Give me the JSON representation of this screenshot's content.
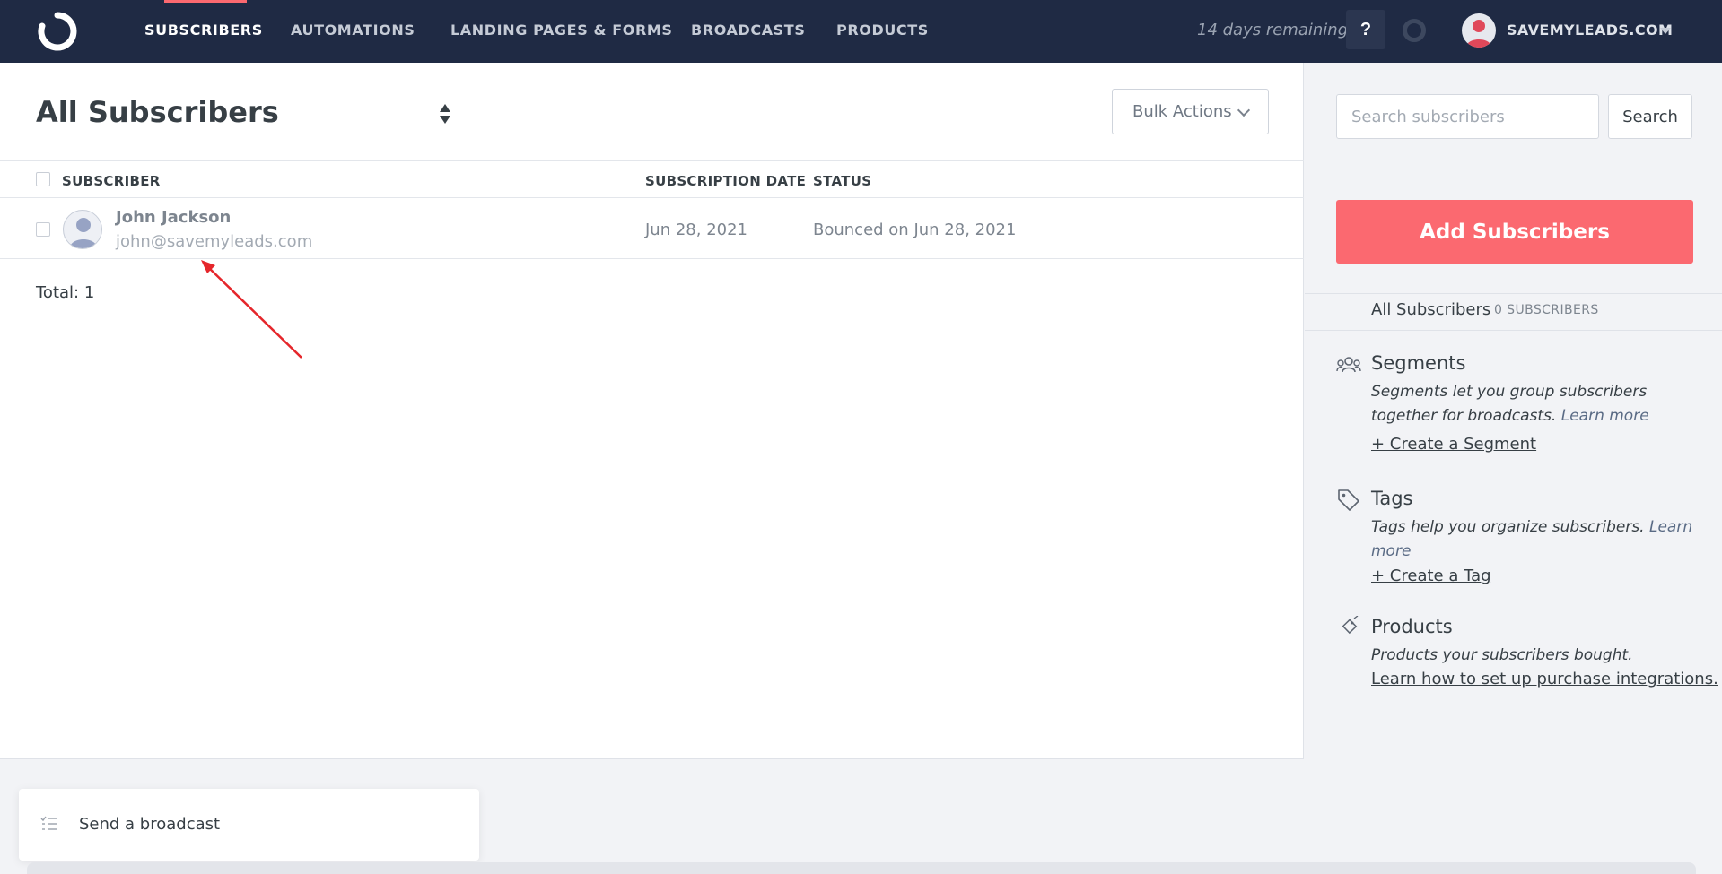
{
  "nav": {
    "items": [
      {
        "label": "SUBSCRIBERS",
        "active": true
      },
      {
        "label": "AUTOMATIONS"
      },
      {
        "label": "LANDING PAGES & FORMS"
      },
      {
        "label": "BROADCASTS"
      },
      {
        "label": "PRODUCTS"
      }
    ],
    "trial_text": "14 days remaining",
    "help_label": "?",
    "account_name": "SAVEMYLEADS.COM"
  },
  "main": {
    "title": "All Subscribers",
    "bulk_actions_label": "Bulk Actions",
    "columns": {
      "subscriber": "SUBSCRIBER",
      "date": "SUBSCRIPTION DATE",
      "status": "STATUS"
    },
    "rows": [
      {
        "name": "John Jackson",
        "email": "john@savemyleads.com",
        "date": "Jun 28, 2021",
        "status": "Bounced on Jun 28, 2021"
      }
    ],
    "total_text": "Total: 1"
  },
  "sidebar": {
    "search_placeholder": "Search subscribers",
    "search_label": "Search",
    "add_label": "Add Subscribers",
    "all_label": "All Subscribers",
    "all_count": "0 SUBSCRIBERS",
    "segments": {
      "title": "Segments",
      "desc": "Segments let you group subscribers together for broadcasts.",
      "learn_more": "Learn more",
      "link": "+ Create a Segment"
    },
    "tags": {
      "title": "Tags",
      "desc": "Tags help you organize subscribers.",
      "learn_more": "Learn more",
      "link": "+ Create a Tag"
    },
    "products": {
      "title": "Products",
      "desc": "Products your subscribers bought.",
      "link": "Learn how to set up purchase integrations."
    }
  },
  "footer": {
    "broadcast_label": "Send a broadcast"
  },
  "colors": {
    "nav_bg": "#1f2a44",
    "accent": "#fb6970",
    "annotation_arrow": "#e5262b"
  },
  "icons": [
    "logo-icon",
    "help-icon",
    "status-ring-icon",
    "user-avatar",
    "sort-icon",
    "chevron-down-icon",
    "segments-icon",
    "tag-icon",
    "product-tag-icon",
    "list-icon"
  ]
}
